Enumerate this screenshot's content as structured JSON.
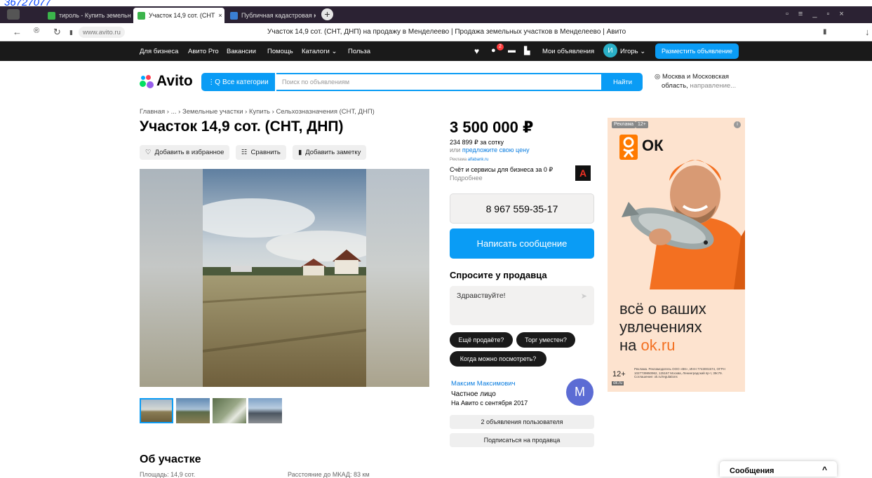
{
  "top_link": "36727077",
  "browser": {
    "tabs": [
      {
        "label": "тироль - Купить земельн"
      },
      {
        "label": "Участок 14,9 сот. (СНТ"
      },
      {
        "label": "Публичная кадастровая к"
      }
    ],
    "url": "www.avito.ru",
    "page_title": "Участок 14,9 сот. (СНТ, ДНП) на продажу в Менделеево | Продажа земельных участков в Менделеево | Авито"
  },
  "topnav": {
    "items": [
      "Для бизнеса",
      "Авито Pro",
      "Вакансии",
      "Помощь",
      "Каталоги ⌄",
      "Польза"
    ],
    "my_ads": "Мои объявления",
    "avatar_letter": "И",
    "user": "Игорь ⌄",
    "post_button": "Разместить объявление",
    "notif_count": "2"
  },
  "header": {
    "logo": "Avito",
    "categories_button": "Все категории",
    "search_placeholder": "Поиск по объявлениям",
    "find_button": "Найти",
    "location_line1": "Москва и Московская",
    "location_line2": "область,",
    "location_dir": "направление..."
  },
  "listing": {
    "breadcrumb": "Главная › ... › Земельные участки › Купить › Сельхозназначения (СНТ, ДНП)",
    "title": "Участок 14,9 сот. (СНТ, ДНП)",
    "actions": [
      "Добавить в избранное",
      "Сравнить",
      "Добавить заметку"
    ],
    "about_heading": "Об участке",
    "about_cut_1": "Площадь: 14,9 сот.",
    "about_cut_2": "Расстояние до МКАД: 83 км"
  },
  "price_block": {
    "price": "3 500 000 ₽",
    "per_unit": "234 899 ₽ за сотку",
    "offer_prefix": "или",
    "offer_link": "предложите свою цену",
    "promo_label": "Реклама",
    "promo_domain": "alfabank.ru",
    "promo_text": "Счёт и сервисы для бизнеса за 0 ₽",
    "promo_more": "Подробнее",
    "promo_logo": "А",
    "phone": "8 967 559-35-17",
    "message_button": "Написать сообщение",
    "ask_heading": "Спросите у продавца",
    "ask_placeholder": "Здравствуйте!",
    "chips": [
      "Ещё продаёте?",
      "Торг уместен?",
      "Когда можно посмотреть?"
    ]
  },
  "seller": {
    "name": "Максим Максимович",
    "type": "Частное лицо",
    "since": "На Авито с сентября 2017",
    "avatar_letter": "М",
    "ads_button": "2 объявления пользователя",
    "subscribe_button": "Подписаться на продавца"
  },
  "ad": {
    "badge": "Реклама",
    "age": "12+",
    "brand": "ОК",
    "line1": "всё о ваших",
    "line2": "увлечениях",
    "line3_prefix": "на",
    "line3_brand": "ok.ru",
    "age_bottom": "12+",
    "fineprint": "Реклама. Рекламодатель ООО «ВК», ИНН 7743001574, ОГРН 1027739850962, 125167 Москва, Ленинградский пр-т, 39с79. Соглашение: ok.ru/regulations",
    "corner": "ok.ru"
  },
  "messages_widget": {
    "label": "Сообщения"
  },
  "colors": {
    "accent": "#0a9cf5",
    "dark": "#1a1a1a",
    "ok_orange": "#ff7a00"
  }
}
